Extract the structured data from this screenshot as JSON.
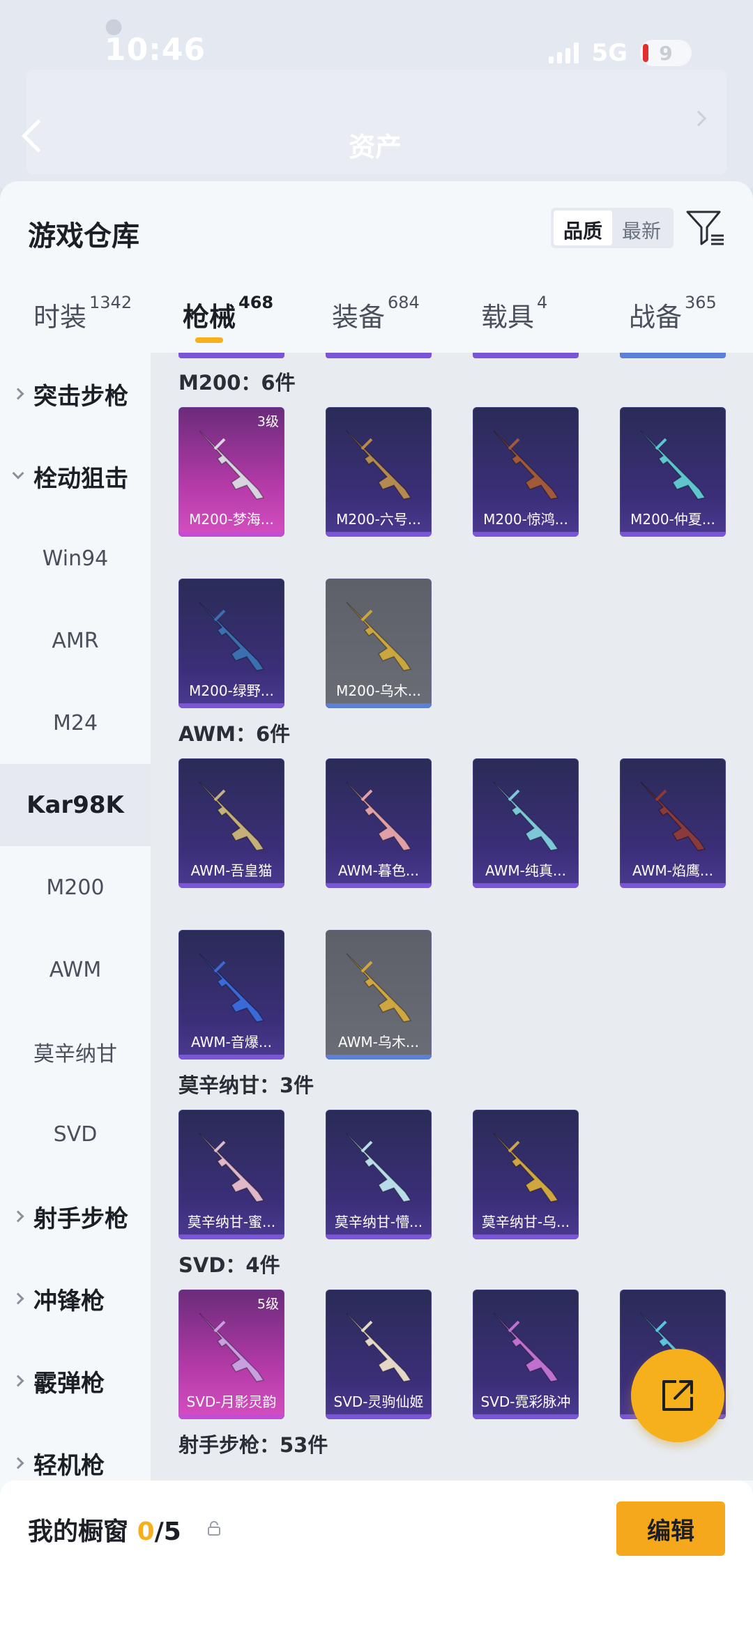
{
  "status_bar": {
    "time": "10:46",
    "network": "5G",
    "battery": "9"
  },
  "header_bg": {
    "asset_label": "资产"
  },
  "sheet": {
    "title": "游戏仓库",
    "sort_options": [
      "品质",
      "最新"
    ],
    "sort_selected": "品质"
  },
  "tabs": [
    {
      "label": "时装",
      "count": "1342"
    },
    {
      "label": "枪械",
      "count": "468"
    },
    {
      "label": "装备",
      "count": "684"
    },
    {
      "label": "载具",
      "count": "4"
    },
    {
      "label": "战备",
      "count": "365"
    }
  ],
  "active_tab": "枪械",
  "sidebar": [
    {
      "label": "突击步枪",
      "type": "group",
      "expanded": false
    },
    {
      "label": "栓动狙击",
      "type": "group",
      "expanded": true
    },
    {
      "label": "Win94",
      "type": "item"
    },
    {
      "label": "AMR",
      "type": "item"
    },
    {
      "label": "M24",
      "type": "item"
    },
    {
      "label": "Kar98K",
      "type": "item",
      "active": true
    },
    {
      "label": "M200",
      "type": "item"
    },
    {
      "label": "AWM",
      "type": "item"
    },
    {
      "label": "莫辛纳甘",
      "type": "item"
    },
    {
      "label": "SVD",
      "type": "item"
    },
    {
      "label": "射手步枪",
      "type": "group",
      "expanded": false
    },
    {
      "label": "冲锋枪",
      "type": "group",
      "expanded": false
    },
    {
      "label": "霰弹枪",
      "type": "group",
      "expanded": false
    },
    {
      "label": "轻机枪",
      "type": "group",
      "expanded": false
    }
  ],
  "sections": [
    {
      "label": "M200：6件",
      "items": [
        {
          "name": "M200-梦海...",
          "level": "3级",
          "rarity": "legend"
        },
        {
          "name": "M200-六号...",
          "rarity": "epic"
        },
        {
          "name": "M200-惊鸿...",
          "rarity": "epic"
        },
        {
          "name": "M200-仲夏...",
          "rarity": "epic"
        },
        {
          "name": "M200-绿野...",
          "rarity": "epic"
        },
        {
          "name": "M200-乌木...",
          "rarity": "gray"
        }
      ]
    },
    {
      "label": "AWM：6件",
      "items": [
        {
          "name": "AWM-吾皇猫",
          "rarity": "epic"
        },
        {
          "name": "AWM-暮色...",
          "rarity": "epic"
        },
        {
          "name": "AWM-纯真...",
          "rarity": "epic"
        },
        {
          "name": "AWM-焰鹰...",
          "rarity": "epic"
        },
        {
          "name": "AWM-音爆...",
          "rarity": "epic"
        },
        {
          "name": "AWM-乌木...",
          "rarity": "gray"
        }
      ]
    },
    {
      "label": "莫辛纳甘：3件",
      "items": [
        {
          "name": "莫辛纳甘-蜜...",
          "rarity": "epic"
        },
        {
          "name": "莫辛纳甘-懵...",
          "rarity": "epic"
        },
        {
          "name": "莫辛纳甘-乌...",
          "rarity": "epic"
        }
      ]
    },
    {
      "label": "SVD：4件",
      "items": [
        {
          "name": "SVD-月影灵韵",
          "level": "5级",
          "rarity": "legend"
        },
        {
          "name": "SVD-灵驹仙姬",
          "rarity": "epic"
        },
        {
          "name": "SVD-霓彩脉冲",
          "rarity": "epic"
        },
        {
          "name": "",
          "rarity": "epic"
        }
      ]
    },
    {
      "label": "射手步枪：53件",
      "items": []
    }
  ],
  "showcase": {
    "label": "我的橱窗",
    "current": "0",
    "total": "/5"
  },
  "edit_label": "编辑",
  "colors": {
    "accent": "#f5b01b",
    "legend": "#d54fc0",
    "epic": "#4b3a91",
    "gray": "#6a6d75"
  }
}
